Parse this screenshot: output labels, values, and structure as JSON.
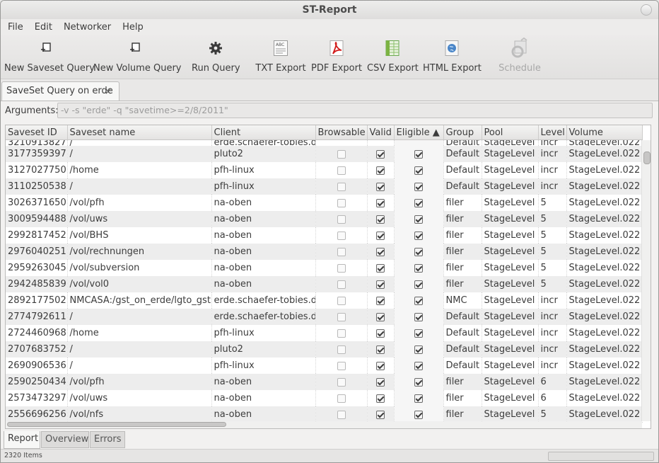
{
  "window": {
    "title": "ST-Report"
  },
  "menu": [
    "File",
    "Edit",
    "Networker",
    "Help"
  ],
  "toolbar": [
    {
      "label": "New Saveset Query",
      "icon": "new-saveset-icon",
      "enabled": true
    },
    {
      "label": "New Volume Query",
      "icon": "new-volume-icon",
      "enabled": true
    },
    {
      "label": "Run Query",
      "icon": "gear-icon",
      "enabled": true
    },
    {
      "label": "TXT Export",
      "icon": "txt-file-icon",
      "enabled": true
    },
    {
      "label": "PDF Export",
      "icon": "pdf-file-icon",
      "enabled": true
    },
    {
      "label": "CSV Export",
      "icon": "spreadsheet-icon",
      "enabled": true
    },
    {
      "label": "HTML Export",
      "icon": "globe-icon",
      "enabled": true
    },
    {
      "label": "Schedule",
      "icon": "schedule-icon",
      "enabled": false
    }
  ],
  "tab": {
    "label": "SaveSet Query on erde",
    "close": "×"
  },
  "arguments": {
    "label": "Arguments:",
    "value": "-v -s \"erde\" -q \"savetime>=2/8/2011\""
  },
  "table": {
    "columns": [
      "Saveset ID",
      "Saveset name",
      "Client",
      "Browsable",
      "Valid",
      "Eligible ▲",
      "Group",
      "Pool",
      "Level",
      "Volume"
    ],
    "partial_top_row": {
      "id": "3210913827",
      "name": "/",
      "client": "erde.schaefer-tobies.de",
      "group": "Default",
      "pool": "StageLevel",
      "level": "incr",
      "volume": "StageLevel.022"
    },
    "rows": [
      {
        "id": "3177359397",
        "name": "/",
        "client": "pluto2",
        "browsable": false,
        "valid": true,
        "eligible": true,
        "group": "Default",
        "pool": "StageLevel",
        "level": "incr",
        "volume": "StageLevel.022"
      },
      {
        "id": "3127027750",
        "name": "/home",
        "client": "pfh-linux",
        "browsable": false,
        "valid": true,
        "eligible": true,
        "group": "Default",
        "pool": "StageLevel",
        "level": "incr",
        "volume": "StageLevel.022"
      },
      {
        "id": "3110250538",
        "name": "/",
        "client": "pfh-linux",
        "browsable": false,
        "valid": true,
        "eligible": true,
        "group": "Default",
        "pool": "StageLevel",
        "level": "incr",
        "volume": "StageLevel.022"
      },
      {
        "id": "3026371650",
        "name": "/vol/pfh",
        "client": "na-oben",
        "browsable": false,
        "valid": true,
        "eligible": true,
        "group": "filer",
        "pool": "StageLevel",
        "level": "5",
        "volume": "StageLevel.022"
      },
      {
        "id": "3009594488",
        "name": "/vol/uws",
        "client": "na-oben",
        "browsable": false,
        "valid": true,
        "eligible": true,
        "group": "filer",
        "pool": "StageLevel",
        "level": "5",
        "volume": "StageLevel.022"
      },
      {
        "id": "2992817452",
        "name": "/vol/BHS",
        "client": "na-oben",
        "browsable": false,
        "valid": true,
        "eligible": true,
        "group": "filer",
        "pool": "StageLevel",
        "level": "5",
        "volume": "StageLevel.022"
      },
      {
        "id": "2976040251",
        "name": "/vol/rechnungen",
        "client": "na-oben",
        "browsable": false,
        "valid": true,
        "eligible": true,
        "group": "filer",
        "pool": "StageLevel",
        "level": "5",
        "volume": "StageLevel.022"
      },
      {
        "id": "2959263045",
        "name": "/vol/subversion",
        "client": "na-oben",
        "browsable": false,
        "valid": true,
        "eligible": true,
        "group": "filer",
        "pool": "StageLevel",
        "level": "5",
        "volume": "StageLevel.022"
      },
      {
        "id": "2942485839",
        "name": "/vol/vol0",
        "client": "na-oben",
        "browsable": false,
        "valid": true,
        "eligible": true,
        "group": "filer",
        "pool": "StageLevel",
        "level": "5",
        "volume": "StageLevel.022"
      },
      {
        "id": "2892177502",
        "name": "NMCASA:/gst_on_erde/lgto_gst",
        "client": "erde.schaefer-tobies.de",
        "browsable": false,
        "valid": true,
        "eligible": true,
        "group": "NMC",
        "pool": "StageLevel",
        "level": "incr",
        "volume": "StageLevel.022"
      },
      {
        "id": "2774792611",
        "name": "/",
        "client": "erde.schaefer-tobies.de",
        "browsable": false,
        "valid": true,
        "eligible": true,
        "group": "Default",
        "pool": "StageLevel",
        "level": "incr",
        "volume": "StageLevel.022"
      },
      {
        "id": "2724460968",
        "name": "/home",
        "client": "pfh-linux",
        "browsable": false,
        "valid": true,
        "eligible": true,
        "group": "Default",
        "pool": "StageLevel",
        "level": "incr",
        "volume": "StageLevel.022"
      },
      {
        "id": "2707683752",
        "name": "/",
        "client": "pluto2",
        "browsable": false,
        "valid": true,
        "eligible": true,
        "group": "Default",
        "pool": "StageLevel",
        "level": "incr",
        "volume": "StageLevel.022"
      },
      {
        "id": "2690906536",
        "name": "/",
        "client": "pfh-linux",
        "browsable": false,
        "valid": true,
        "eligible": true,
        "group": "Default",
        "pool": "StageLevel",
        "level": "incr",
        "volume": "StageLevel.022"
      },
      {
        "id": "2590250434",
        "name": "/vol/pfh",
        "client": "na-oben",
        "browsable": false,
        "valid": true,
        "eligible": true,
        "group": "filer",
        "pool": "StageLevel",
        "level": "6",
        "volume": "StageLevel.022"
      },
      {
        "id": "2573473297",
        "name": "/vol/uws",
        "client": "na-oben",
        "browsable": false,
        "valid": true,
        "eligible": true,
        "group": "filer",
        "pool": "StageLevel",
        "level": "6",
        "volume": "StageLevel.022"
      },
      {
        "id": "2556696256",
        "name": "/vol/nfs",
        "client": "na-oben",
        "browsable": false,
        "valid": true,
        "eligible": true,
        "group": "filer",
        "pool": "StageLevel",
        "level": "5",
        "volume": "StageLevel.022"
      }
    ]
  },
  "bottom_tabs": [
    "Report",
    "Overview",
    "Errors"
  ],
  "status": {
    "text": "2320 Items"
  }
}
